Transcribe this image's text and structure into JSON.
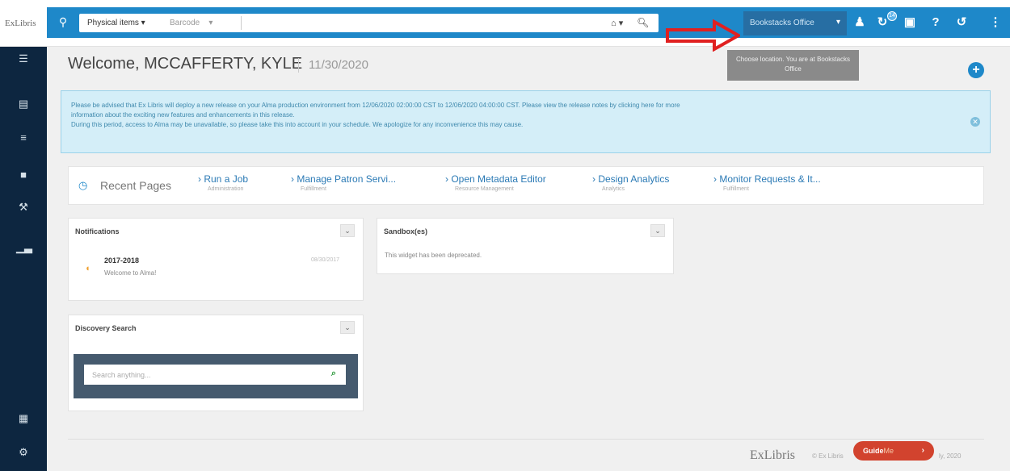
{
  "brand": {
    "logo_text": "ExLibris"
  },
  "topbar": {
    "search_scope": "Physical items ▾",
    "search_field": "Barcode",
    "search_field_caret": "▾",
    "home_label": "⌂ ▾",
    "location": "Bookstacks Office",
    "location_caret": "▾",
    "notification_count": "14"
  },
  "tooltip": {
    "text": "Choose location. You are at Bookstacks Office"
  },
  "header": {
    "welcome": "Welcome, MCCAFFERTY, KYLE",
    "date": "11/30/2020"
  },
  "alert": {
    "line1": "Please be advised that Ex Libris will deploy a new release on your Alma production environment from 12/06/2020 02:00:00 CST to 12/06/2020 04:00:00 CST. Please view the release notes by clicking here for more",
    "line2": "information about the exciting new features and enhancements in this release.",
    "line3": "During this period, access to Alma may be unavailable, so please take this into account in your schedule. We apologize for any inconvenience this may cause."
  },
  "recent": {
    "title": "Recent Pages",
    "links": [
      {
        "label": "Run a Job",
        "sub": "Administration"
      },
      {
        "label": "Manage Patron Servi...",
        "sub": "Fulfillment"
      },
      {
        "label": "Open Metadata Editor",
        "sub": "Resource Management"
      },
      {
        "label": "Design Analytics",
        "sub": "Analytics"
      },
      {
        "label": "Monitor Requests & It...",
        "sub": "Fulfillment"
      }
    ]
  },
  "notifications": {
    "title": "Notifications",
    "item_title": "2017-2018",
    "item_sub": "Welcome to Alma!",
    "item_date": "08/30/2017"
  },
  "sandbox": {
    "title": "Sandbox(es)",
    "text": "This widget has been deprecated."
  },
  "discovery": {
    "title": "Discovery Search",
    "placeholder": "Search anything..."
  },
  "footer": {
    "logo": "ExLibris",
    "copyright_left": "© Ex Libris",
    "copyright_right": "ly, 2020",
    "guide_label": "Guide",
    "guide_me": "Me"
  }
}
